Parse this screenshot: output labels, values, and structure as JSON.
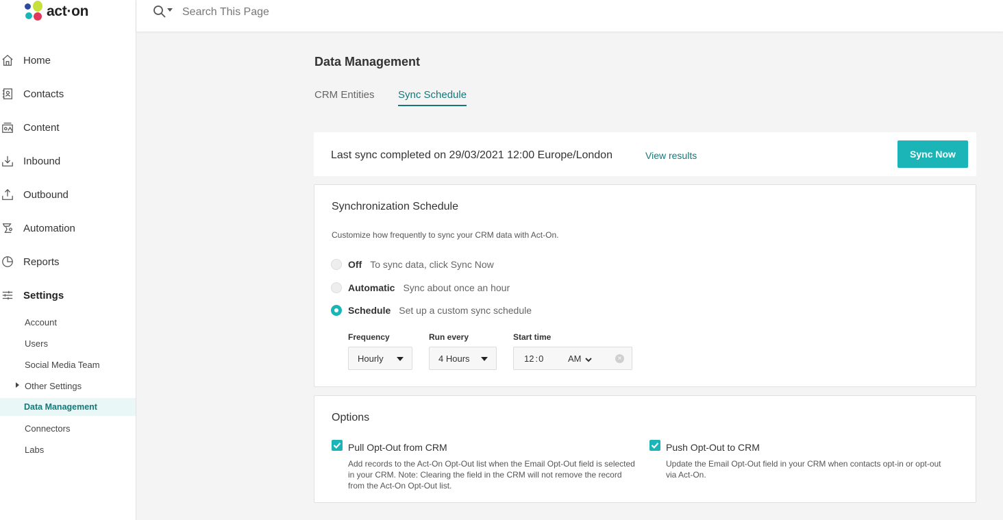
{
  "brand": {
    "logo_text": "act·on"
  },
  "search": {
    "placeholder": "Search This Page"
  },
  "nav": {
    "home": "Home",
    "contacts": "Contacts",
    "content": "Content",
    "inbound": "Inbound",
    "outbound": "Outbound",
    "automation": "Automation",
    "reports": "Reports",
    "settings": "Settings"
  },
  "settings_sub": {
    "account": "Account",
    "users": "Users",
    "social": "Social Media Team",
    "other": "Other Settings",
    "data_mgmt": "Data Management",
    "connectors": "Connectors",
    "labs": "Labs"
  },
  "page": {
    "title": "Data Management"
  },
  "tabs": {
    "crm": "CRM Entities",
    "sync": "Sync Schedule"
  },
  "sync_bar": {
    "text": "Last sync completed on 29/03/2021 12:00 Europe/London",
    "view_results": "View results",
    "button": "Sync Now"
  },
  "schedule": {
    "title": "Synchronization Schedule",
    "description": "Customize how frequently to sync your CRM data with Act-On.",
    "off_name": "Off",
    "off_desc": "To sync data, click Sync Now",
    "auto_name": "Automatic",
    "auto_desc": "Sync about once an hour",
    "sched_name": "Schedule",
    "sched_desc": "Set up a custom sync schedule",
    "selected": "Schedule",
    "frequency_label": "Frequency",
    "frequency_value": "Hourly",
    "run_label": "Run every",
    "run_value": "4 Hours",
    "start_label": "Start time",
    "start_hour": "12",
    "start_sep": ":",
    "start_min": "0",
    "start_ampm": "AM"
  },
  "options": {
    "title": "Options",
    "pull_label": "Pull Opt-Out from CRM",
    "pull_desc": "Add records to the Act-On Opt-Out list when the Email Opt-Out field is selected in your CRM. Note: Clearing the field in the CRM will not remove the record from the Act-On Opt-Out list.",
    "push_label": "Push Opt-Out to CRM",
    "push_desc": "Update the Email Opt-Out field in your CRM when contacts opt-in or opt-out via Act-On."
  },
  "colors": {
    "accent": "#1bb5b8",
    "accent_dark": "#127a7a",
    "selected_bg": "#eaf7f7"
  }
}
